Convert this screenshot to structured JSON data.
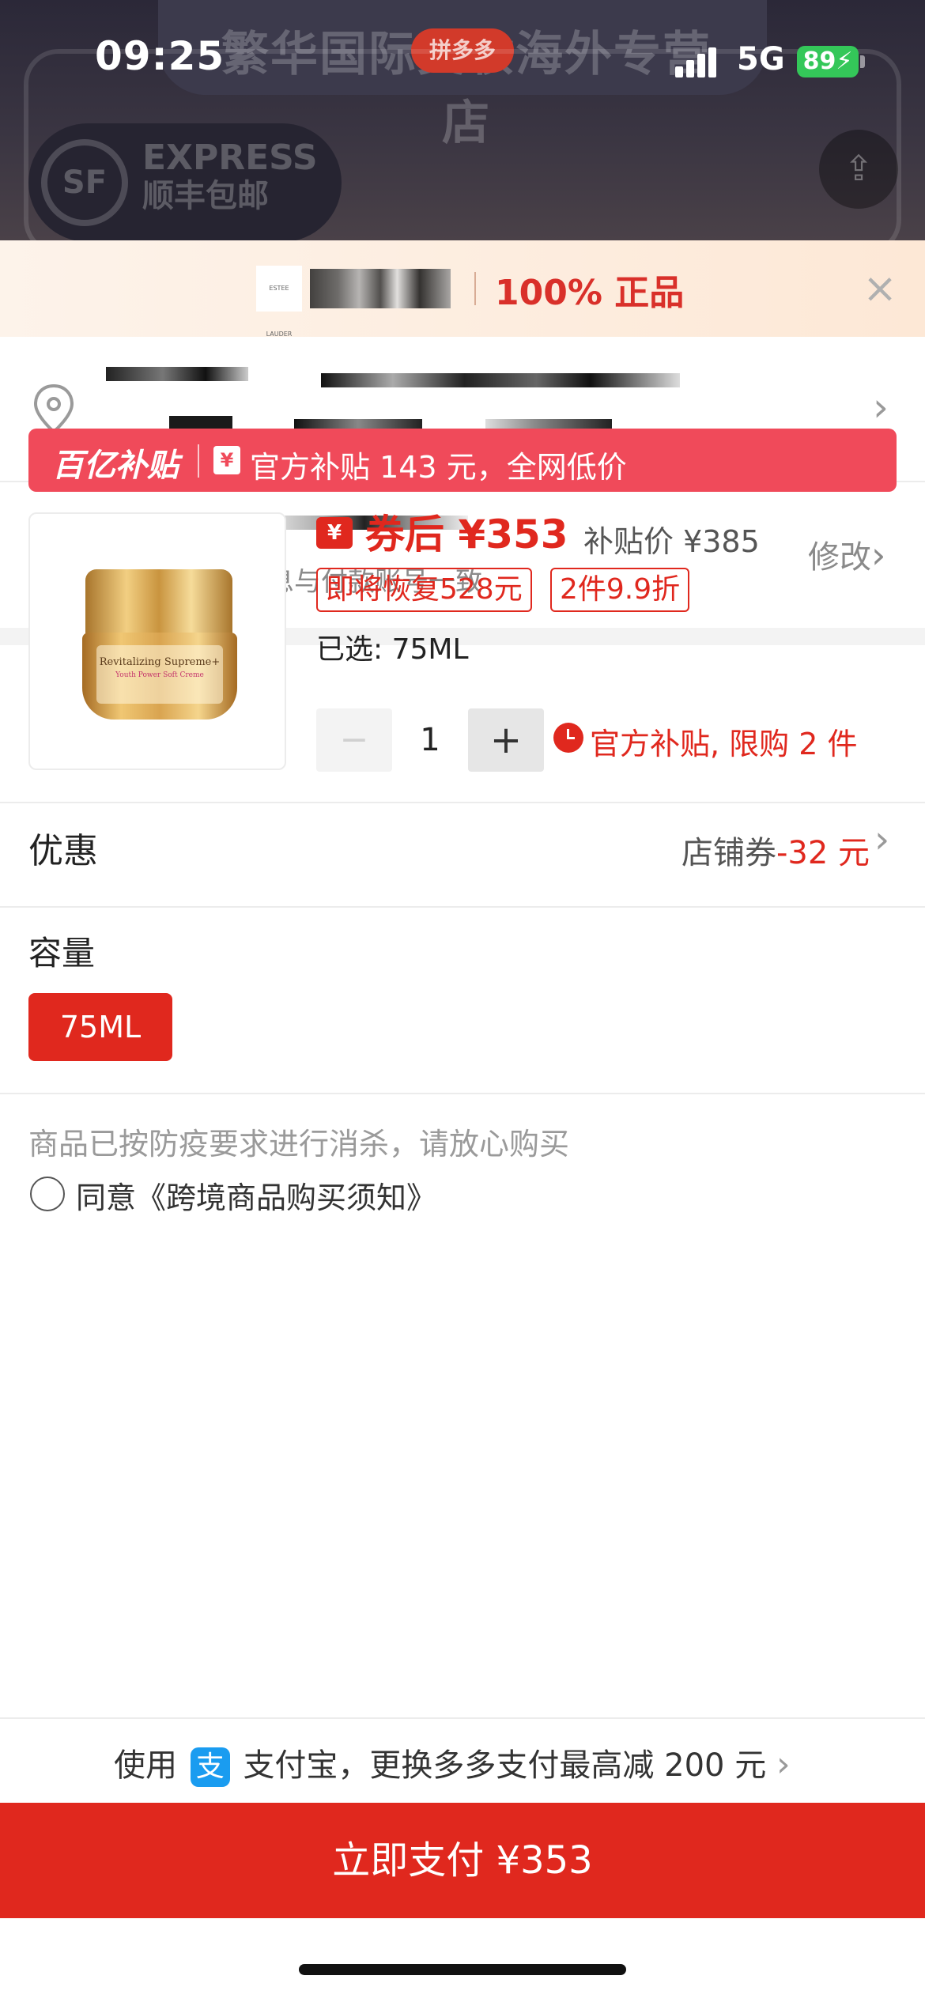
{
  "status_bar": {
    "time": "09:25",
    "network": "5G",
    "battery": "89"
  },
  "background": {
    "store_title": "繁华国际美妆海外专营店",
    "pdd_badge": "拼多多",
    "express_line1": "EXPRESS",
    "express_line2": "顺丰包邮",
    "sf_logo": "SF"
  },
  "auth_bar": {
    "brand_logo": "ESTEE LAUDER",
    "text": "100% 正品"
  },
  "address": {
    "icon": "location-pin-icon"
  },
  "identity": {
    "hint": "请确保实名信息与付款账号一致",
    "edit_label": "修改"
  },
  "subsidy": {
    "brand": "百亿补贴",
    "coin": "¥",
    "text": "官方补贴 143 元，全网低价"
  },
  "product": {
    "coupon_icon": "¥",
    "price_after_coupon": "券后 ¥353",
    "subsidy_price": "补贴价 ¥385",
    "tags": [
      "即将恢复528元",
      "2件9.9折"
    ],
    "selected": "已选: 75ML",
    "quantity": "1",
    "minus": "−",
    "plus": "+",
    "limit_text": "官方补贴, 限购 2 件",
    "image_label": "Revitalizing Supreme+",
    "image_sublabel": "Youth Power Soft Creme"
  },
  "promo": {
    "label": "优惠",
    "value_prefix": "店铺券",
    "value_amount": "-32 元"
  },
  "capacity": {
    "label": "容量",
    "option": "75ML"
  },
  "notice": {
    "text": "商品已按防疫要求进行消杀，请放心购买",
    "agree": "同意《跨境商品购买须知》"
  },
  "payment": {
    "hint_before": "使用",
    "alipay_icon": "支",
    "hint_after": "支付宝，更换多多支付最高减 200 元",
    "button": "立即支付 ¥353"
  },
  "colors": {
    "accent_red": "#e0281e",
    "subsidy_red": "#f04a5a",
    "alipay_blue": "#1a9cf0",
    "battery_green": "#34c759"
  }
}
